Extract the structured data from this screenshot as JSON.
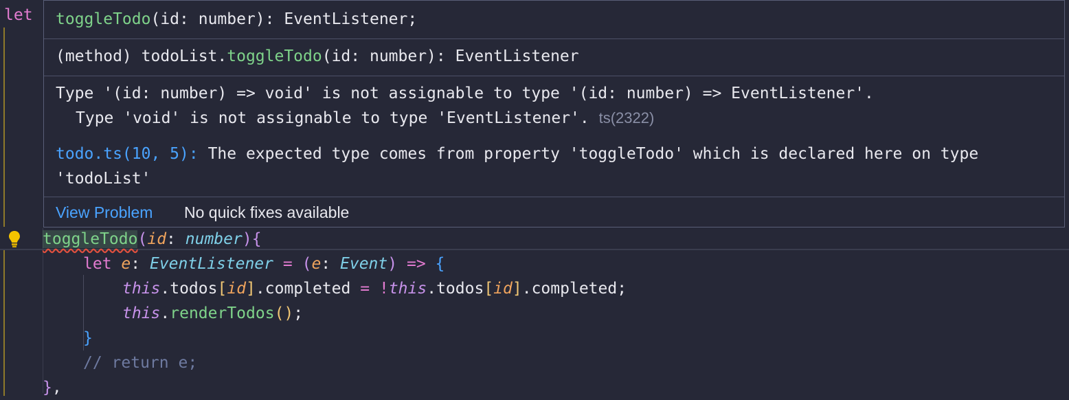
{
  "editor": {
    "partial_line": "let",
    "lines": {
      "l1": {
        "fn_name": "toggleTodo",
        "open_paren": "(",
        "param": "id",
        "colon": ":",
        "type": "number",
        "close": ")",
        "brace": "{"
      },
      "l2": {
        "kw": "let",
        "var": "e",
        "colon": ":",
        "type": "EventListener",
        "eq": "=",
        "open": "(",
        "param": "e",
        "colon2": ":",
        "ptype": "Event",
        "close": ")",
        "arrow": "=>",
        "brace": "{"
      },
      "l3": {
        "this": "this",
        "a": ".todos",
        "b1": "[",
        "idx": "id",
        "b2": "]",
        "c": ".completed",
        "eq": "=",
        "not": "!",
        "this2": "this",
        "d": ".todos",
        "b3": "[",
        "idx2": "id",
        "b4": "]",
        "e": ".completed;"
      },
      "l4": {
        "this": "this",
        "dot": ".",
        "fn": "renderTodos",
        "parens": "()",
        "semi": ";"
      },
      "l5": {
        "brace": "}"
      },
      "l6": {
        "comment": "// return e;"
      },
      "l7": {
        "brace": "}",
        "comma": ","
      }
    }
  },
  "hover": {
    "signature": {
      "fn": "toggleTodo",
      "rest": "(id: number): EventListener;"
    },
    "method": {
      "prefix": "(method) todoList.",
      "fn": "toggleTodo",
      "rest": "(id: number): EventListener"
    },
    "error": {
      "line1": "Type '(id: number) => void' is not assignable to type '(id: number) => EventListener'.",
      "line2": "Type 'void' is not assignable to type 'EventListener'.",
      "code": "ts(2322)",
      "ref_link": "todo.ts(10, 5):",
      "ref_text": " The expected type comes from property 'toggleTodo' which is declared here on type",
      "ref_text2": "'todoList'"
    },
    "actions": {
      "view_problem": "View Problem",
      "no_fixes": "No quick fixes available"
    }
  },
  "colors": {
    "accent": "#4aa3ff",
    "function": "#7fd38a",
    "keyword": "#e27bd0",
    "error": "#e0503e",
    "background": "#262837"
  }
}
